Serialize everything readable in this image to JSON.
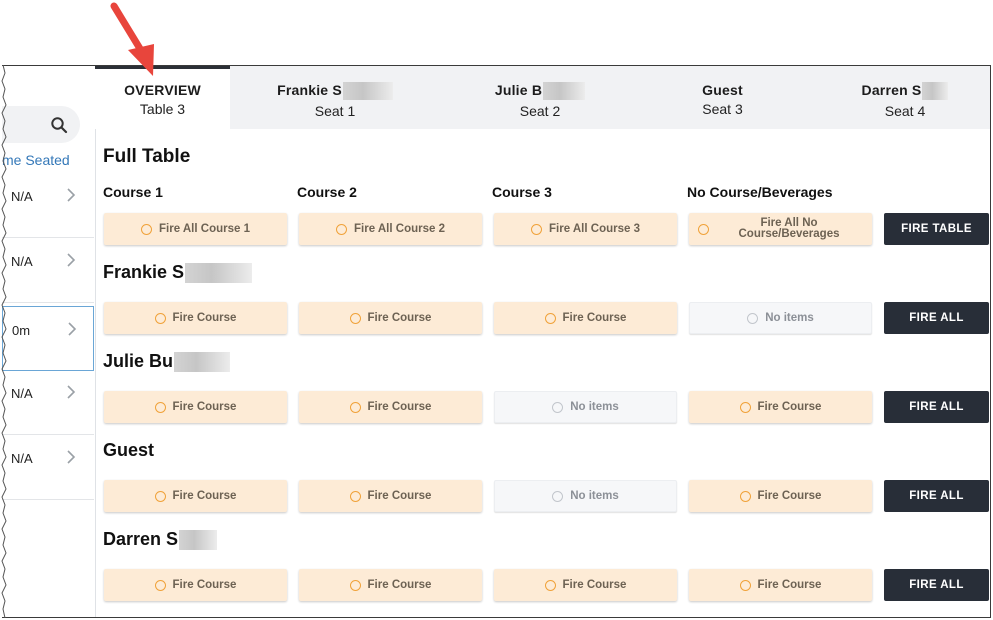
{
  "colors": {
    "accent_peach": "#fdebd6",
    "circle_orange": "#f0a23a",
    "dark_button": "#282e38",
    "link_blue": "#3478b8",
    "arrow_red": "#e8453c"
  },
  "left_panel": {
    "search_icon": "search-icon",
    "column_header": "me Seated",
    "rows": [
      {
        "value": "N/A",
        "selected": false
      },
      {
        "value": "N/A",
        "selected": false
      },
      {
        "value": "0m",
        "selected": true
      },
      {
        "value": "N/A",
        "selected": false
      },
      {
        "value": "N/A",
        "selected": false
      }
    ]
  },
  "tabs": [
    {
      "title": "OVERVIEW",
      "subtitle": "Table 3",
      "active": true
    },
    {
      "title": "Frankie S",
      "subtitle": "Seat 1",
      "active": false
    },
    {
      "title": "Julie B",
      "subtitle": "Seat 2",
      "active": false
    },
    {
      "title": "Guest",
      "subtitle": "Seat 3",
      "active": false
    },
    {
      "title": "Darren S",
      "subtitle": "Seat 4",
      "active": false
    }
  ],
  "full_table": {
    "title": "Full Table",
    "course_headers": [
      "Course 1",
      "Course 2",
      "Course 3",
      "No Course/Beverages"
    ],
    "buttons": [
      "Fire All Course 1",
      "Fire All Course 2",
      "Fire All Course 3",
      "Fire All No Course/Beverages"
    ],
    "fire_table_label": "FIRE TABLE"
  },
  "seats": [
    {
      "name": "Frankie S",
      "buttons": [
        "Fire Course",
        "Fire Course",
        "Fire Course",
        "No items"
      ],
      "fire_all_label": "FIRE ALL"
    },
    {
      "name": "Julie Bu",
      "buttons": [
        "Fire Course",
        "Fire Course",
        "No items",
        "Fire Course"
      ],
      "fire_all_label": "FIRE ALL"
    },
    {
      "name": "Guest",
      "buttons": [
        "Fire Course",
        "Fire Course",
        "No items",
        "Fire Course"
      ],
      "fire_all_label": "FIRE ALL"
    },
    {
      "name": "Darren S",
      "buttons": [
        "Fire Course",
        "Fire Course",
        "Fire Course",
        "Fire Course"
      ],
      "fire_all_label": "FIRE ALL"
    }
  ]
}
